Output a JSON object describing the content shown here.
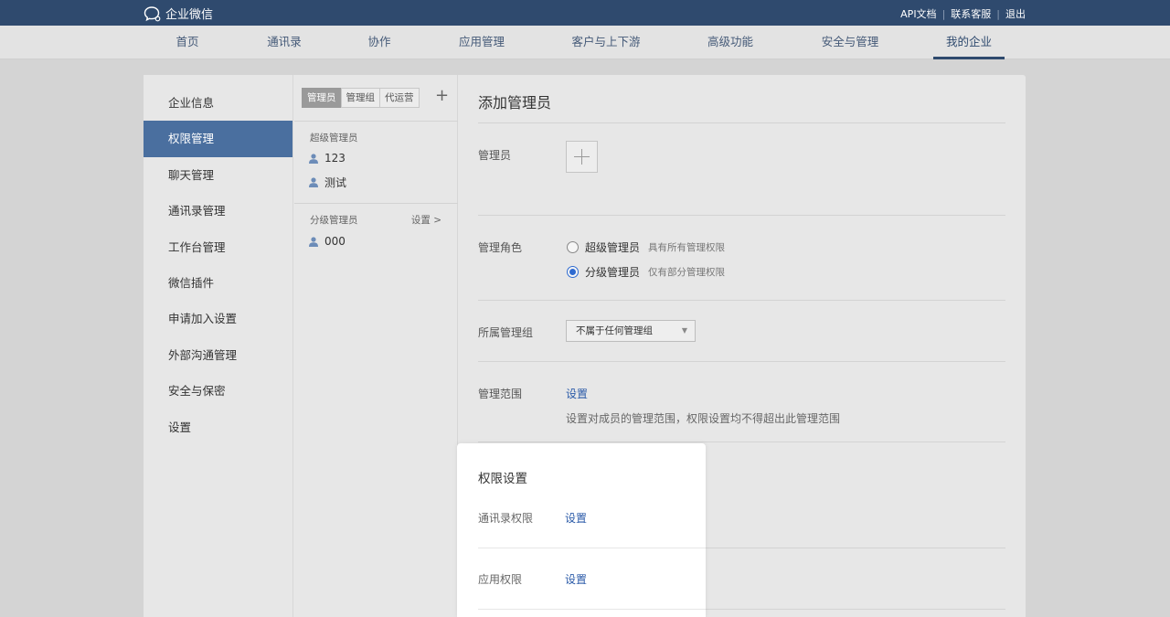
{
  "topbar": {
    "logo_text": "企业微信",
    "links": [
      "API文档",
      "联系客服",
      "退出"
    ],
    "separator": "|"
  },
  "nav": {
    "items": [
      "首页",
      "通讯录",
      "协作",
      "应用管理",
      "客户与上下游",
      "高级功能",
      "安全与管理",
      "我的企业"
    ],
    "active": "我的企业"
  },
  "sidebar": {
    "items": [
      "企业信息",
      "权限管理",
      "聊天管理",
      "通讯录管理",
      "工作台管理",
      "微信插件",
      "申请加入设置",
      "外部沟通管理",
      "安全与保密",
      "设置"
    ],
    "active": "权限管理"
  },
  "admin_list": {
    "tabs": [
      "管理员",
      "管理组",
      "代运营"
    ],
    "active_tab": "管理员",
    "add": "+",
    "super_label": "超级管理员",
    "super_members": [
      "123",
      "测试"
    ],
    "branch_label": "分级管理员",
    "branch_set": "设置 >",
    "branch_members": [
      "000"
    ]
  },
  "form": {
    "title": "添加管理员",
    "admin_label": "管理员",
    "role_label": "管理角色",
    "roles": [
      {
        "name": "超级管理员",
        "desc": "具有所有管理权限",
        "checked": false
      },
      {
        "name": "分级管理员",
        "desc": "仅有部分管理权限",
        "checked": true
      }
    ],
    "group_label": "所属管理组",
    "group_value": "不属于任何管理组",
    "scope_label": "管理范围",
    "scope_link": "设置",
    "scope_hint": "设置对成员的管理范围，权限设置均不得超出此管理范围"
  },
  "permissions": {
    "title": "权限设置",
    "contacts_label": "通讯录权限",
    "contacts_link": "设置",
    "apps_label": "应用权限",
    "apps_link": "设置"
  }
}
